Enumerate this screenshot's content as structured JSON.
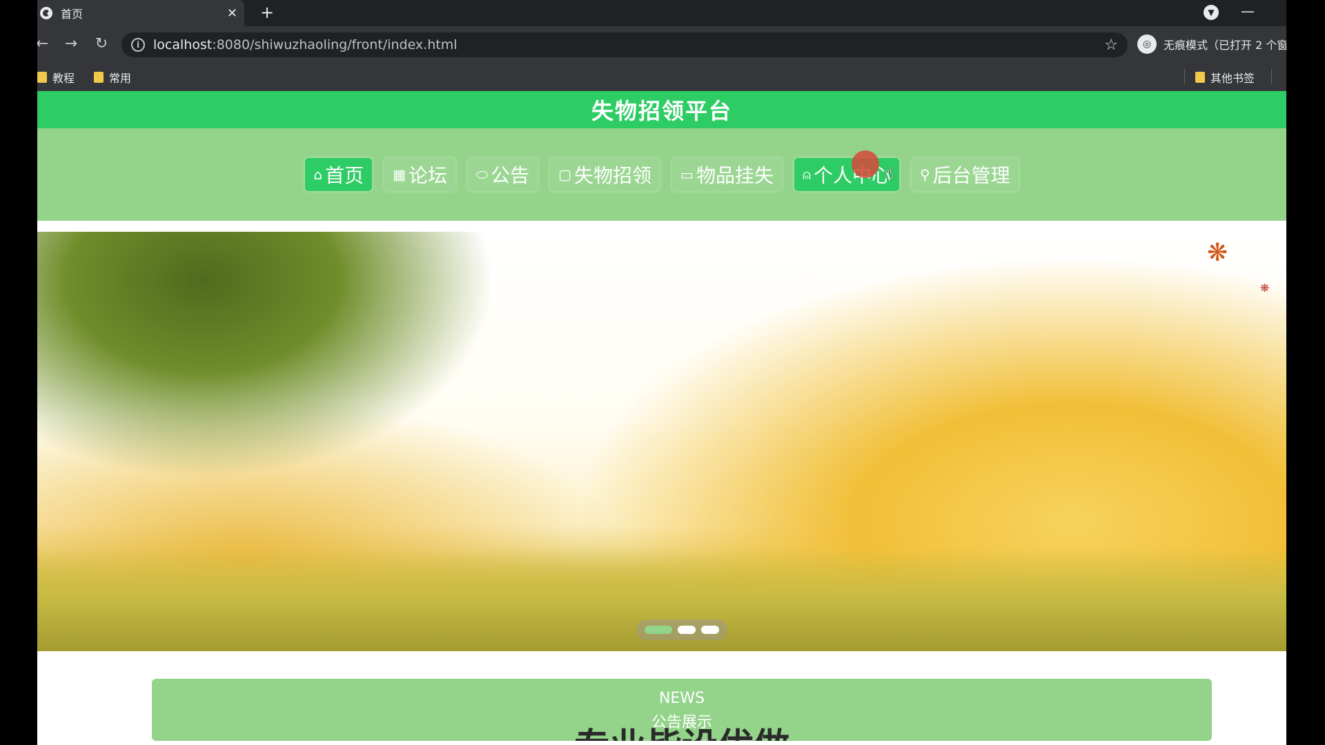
{
  "browser": {
    "tab": {
      "title": "首页",
      "close": "✕"
    },
    "new_tab": "+",
    "address": {
      "host": "localhost",
      "path": ":8080/shiwuzhaoling/front/index.html"
    },
    "incognito_label": "无痕模式（已打开 2 个窗",
    "bookmarks": [
      {
        "label": "教程"
      },
      {
        "label": "常用"
      }
    ],
    "other_bookmarks": "其他书签"
  },
  "site": {
    "title": "失物招领平台",
    "nav": [
      {
        "label": "首页",
        "icon": "⌂",
        "active": true
      },
      {
        "label": "论坛",
        "icon": "▦",
        "active": false
      },
      {
        "label": "公告",
        "icon": "⬭",
        "active": false
      },
      {
        "label": "失物招领",
        "icon": "▢",
        "active": false
      },
      {
        "label": "物品挂失",
        "icon": "▭",
        "active": false
      },
      {
        "label": "个人中心",
        "icon": "⍝",
        "active": true
      },
      {
        "label": "后台管理",
        "icon": "⚲",
        "active": false
      }
    ],
    "carousel": {
      "slides": 3,
      "active_index": 0
    },
    "news": {
      "label": "NEWS",
      "subtitle": "公告展示",
      "overflow_text": "专业皆设优做"
    }
  },
  "colors": {
    "header_green": "#2ecc64",
    "nav_green": "#93d48a",
    "active_green": "#2ecc64"
  }
}
